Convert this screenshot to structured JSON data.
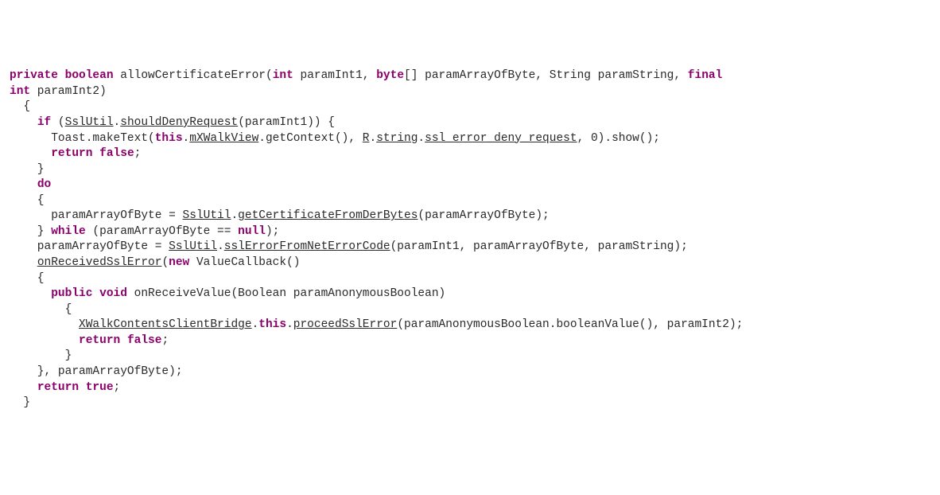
{
  "line1": {
    "t1": "private",
    "t2": "boolean",
    "t3": " allowCertificateError(",
    "t4": "int",
    "t5": " paramInt1, ",
    "t6": "byte",
    "t7": "[] paramArrayOfByte, String paramString, ",
    "t8": "final"
  },
  "line2": {
    "t1": "int",
    "t2": " paramInt2)"
  },
  "line3": "  {",
  "line4": {
    "t1": "    ",
    "t2": "if",
    "t3": " (",
    "t4": "SslUtil",
    "t5": ".",
    "t6": "shouldDenyRequest",
    "t7": "(paramInt1)) {"
  },
  "line5": {
    "t1": "      Toast.makeText(",
    "t2": "this",
    "t3": ".",
    "t4": "mXWalkView",
    "t5": ".getContext(), ",
    "t6": "R",
    "t7": ".",
    "t8": "string",
    "t9": ".",
    "t10": "ssl_error_deny_request",
    "t11": ", 0).show();"
  },
  "line6": {
    "t1": "      ",
    "t2": "return",
    "t3": " ",
    "t4": "false",
    "t5": ";"
  },
  "line7": "    }",
  "line8": {
    "t1": "    ",
    "t2": "do"
  },
  "line9": "    {",
  "line10": {
    "t1": "      paramArrayOfByte = ",
    "t2": "SslUtil",
    "t3": ".",
    "t4": "getCertificateFromDerBytes",
    "t5": "(paramArrayOfByte);"
  },
  "line11": {
    "t1": "    } ",
    "t2": "while",
    "t3": " (paramArrayOfByte == ",
    "t4": "null",
    "t5": ");"
  },
  "line12": {
    "t1": "    paramArrayOfByte = ",
    "t2": "SslUtil",
    "t3": ".",
    "t4": "sslErrorFromNetErrorCode",
    "t5": "(paramInt1, paramArrayOfByte, paramString);"
  },
  "line13": {
    "t1": "    ",
    "t2": "onReceivedSslError",
    "t3": "(",
    "t4": "new",
    "t5": " ValueCallback()"
  },
  "line14": "    {",
  "line15": {
    "t1": "      ",
    "t2": "public",
    "t3": " ",
    "t4": "void",
    "t5": " onReceiveValue(Boolean paramAnonymousBoolean)"
  },
  "line16": "        {",
  "line17": {
    "t1": "          ",
    "t2": "XWalkContentsClientBridge",
    "t3": ".",
    "t4": "this",
    "t5": ".",
    "t6": "proceedSslError",
    "t7": "(paramAnonymousBoolean.booleanValue(), paramInt2);"
  },
  "line18": {
    "t1": "          ",
    "t2": "return",
    "t3": " ",
    "t4": "false",
    "t5": ";"
  },
  "line19": "        }",
  "line20": "    }, paramArrayOfByte);",
  "line21": {
    "t1": "    ",
    "t2": "return",
    "t3": " ",
    "t4": "true",
    "t5": ";"
  },
  "line22": "  }"
}
